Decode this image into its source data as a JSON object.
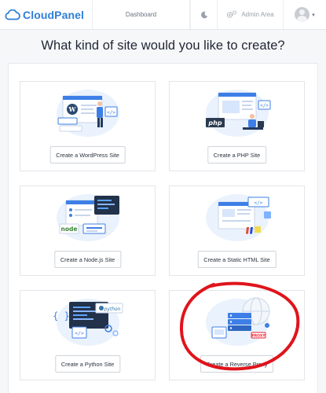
{
  "header": {
    "brand": "CloudPanel",
    "dashboard": "Dashboard",
    "admin_area": "Admin Area"
  },
  "title": "What kind of site would you like to create?",
  "cards": [
    {
      "label": "Create a WordPress Site",
      "illustration": "wordpress-illustration"
    },
    {
      "label": "Create a PHP Site",
      "illustration": "php-illustration",
      "badge": "php"
    },
    {
      "label": "Create a Node.js Site",
      "illustration": "nodejs-illustration",
      "badge": "node"
    },
    {
      "label": "Create a Static HTML Site",
      "illustration": "static-html-illustration"
    },
    {
      "label": "Create a Python Site",
      "illustration": "python-illustration",
      "badge": "python"
    },
    {
      "label": "Create a Reverse Proxy",
      "illustration": "reverse-proxy-illustration",
      "badge": "PROXY"
    }
  ],
  "colors": {
    "brand": "#2f7fd6",
    "annotation": "#e0141b",
    "illustration_blue": "#3d7fe6"
  },
  "icons": [
    "cloud-logo-icon",
    "moon-icon",
    "gears-icon",
    "avatar-icon",
    "caret-down-icon"
  ]
}
